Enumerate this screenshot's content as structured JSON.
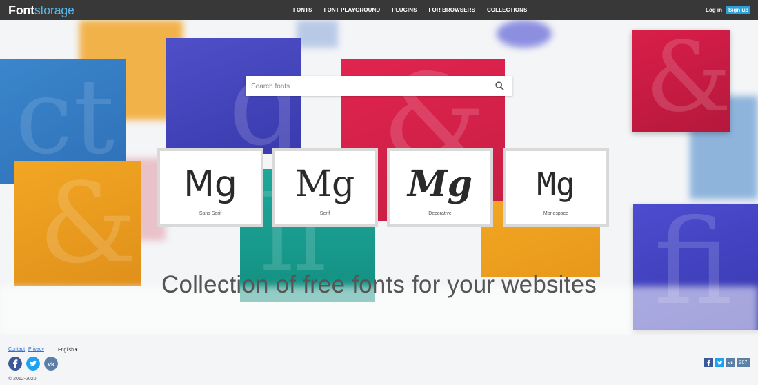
{
  "header": {
    "logo_part1": "Font",
    "logo_part2": "storage",
    "nav": [
      "FONTS",
      "FONT PLAYGROUND",
      "PLUGINS",
      "FOR BROWSERS",
      "COLLECTIONS"
    ],
    "login": "Log in",
    "signup": "Sign up"
  },
  "search": {
    "placeholder": "Search fonts"
  },
  "categories": [
    {
      "sample": "Mg",
      "label": "Sans Serif"
    },
    {
      "sample": "Mg",
      "label": "Serif"
    },
    {
      "sample": "Mg",
      "label": "Decorative"
    },
    {
      "sample": "Mg",
      "label": "Monospace"
    }
  ],
  "tagline": "Collection of free fonts for your websites",
  "footer": {
    "contact": "Contact",
    "privacy": "Privacy",
    "language": "English ▾",
    "copyright": "© 2012-2020",
    "share_count": "207"
  },
  "colors": {
    "header_bg": "#383838",
    "accent": "#2b9fd8",
    "facebook": "#3b5998",
    "twitter": "#1da1f2",
    "vk": "#5b7fa6"
  },
  "icons": [
    "search-icon",
    "facebook-icon",
    "twitter-icon",
    "vk-icon"
  ]
}
